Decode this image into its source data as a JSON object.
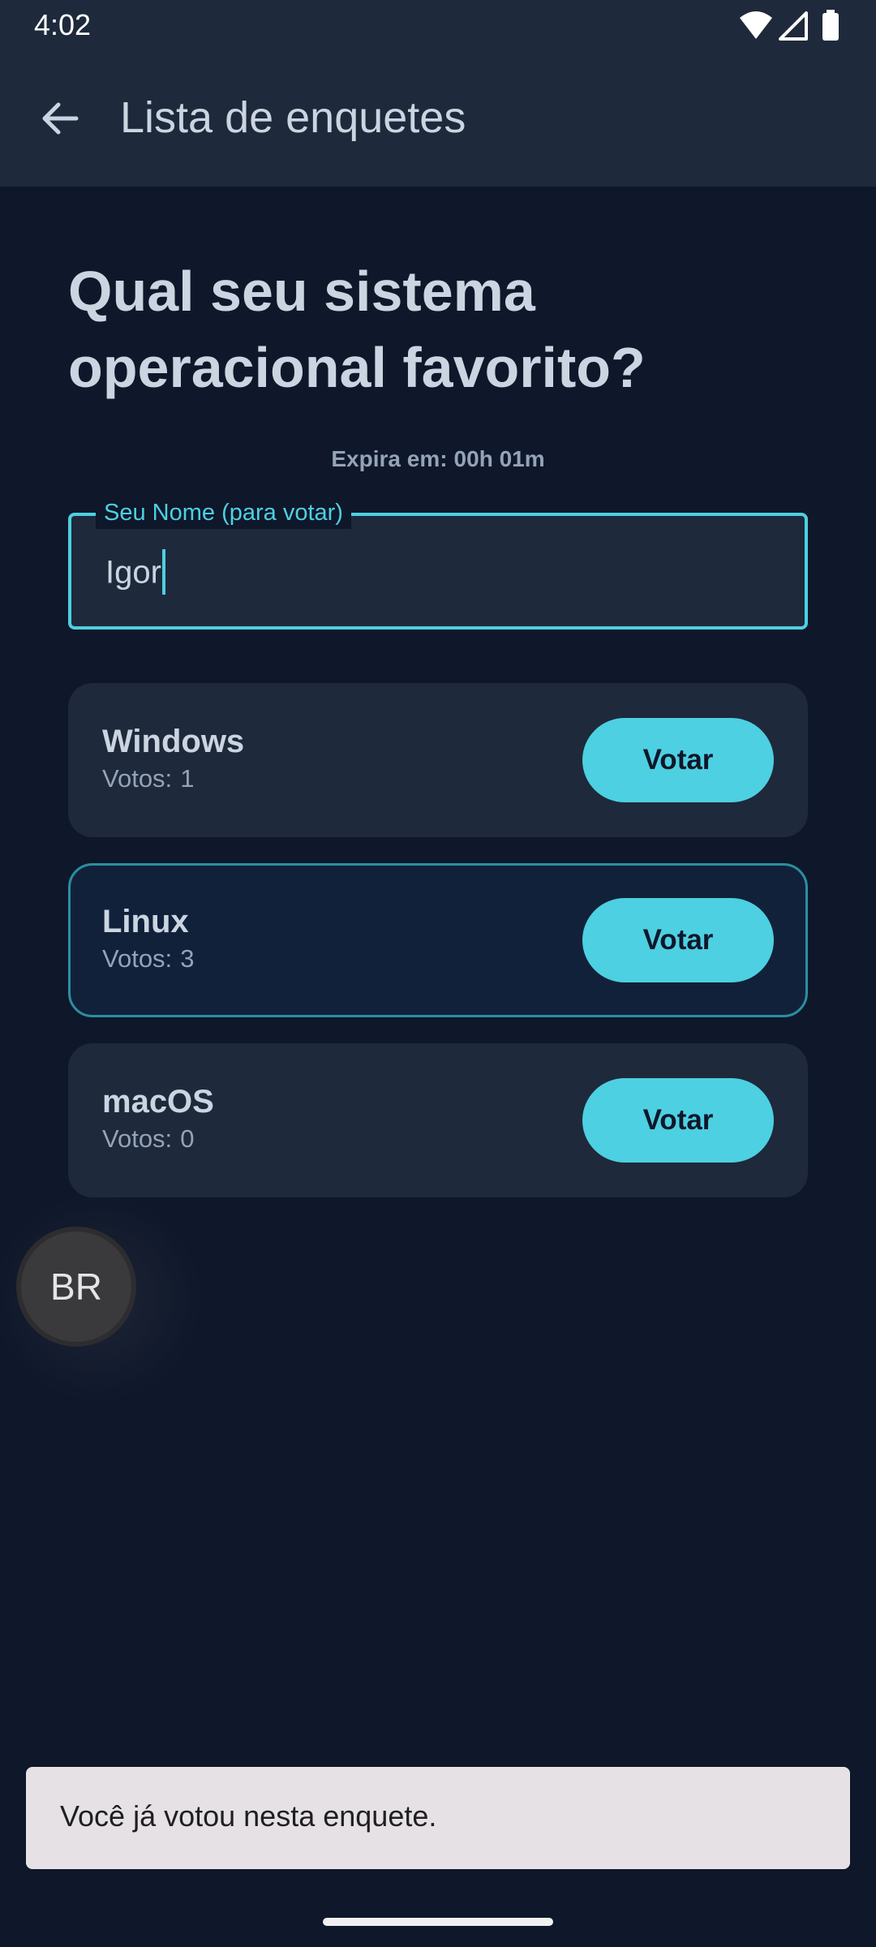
{
  "status_bar": {
    "time": "4:02",
    "icons": [
      "wifi-icon",
      "cell-signal-icon",
      "battery-icon"
    ]
  },
  "app_bar": {
    "title": "Lista de enquetes",
    "back_icon": "arrow-back-icon"
  },
  "poll": {
    "question": "Qual seu sistema operacional favorito?",
    "expires_label": "Expira em:",
    "expires_value": "00h 01m",
    "name_field": {
      "label": "Seu Nome (para votar)",
      "value": "Igor"
    },
    "options": [
      {
        "name": "Windows",
        "votes_label": "Votos:",
        "votes": "1",
        "button": "Votar",
        "selected": false
      },
      {
        "name": "Linux",
        "votes_label": "Votos:",
        "votes": "3",
        "button": "Votar",
        "selected": true
      },
      {
        "name": "macOS",
        "votes_label": "Votos:",
        "votes": "0",
        "button": "Votar",
        "selected": false
      }
    ]
  },
  "bubble": {
    "text": "BR"
  },
  "snackbar": {
    "text": "Você já votou nesta enquete."
  },
  "colors": {
    "background": "#0f172a",
    "surface": "#1e293b",
    "accent": "#4dd0e1",
    "text_primary": "#cbd5e1",
    "text_secondary": "#94a3b8",
    "snackbar": "#e6e1e5"
  }
}
